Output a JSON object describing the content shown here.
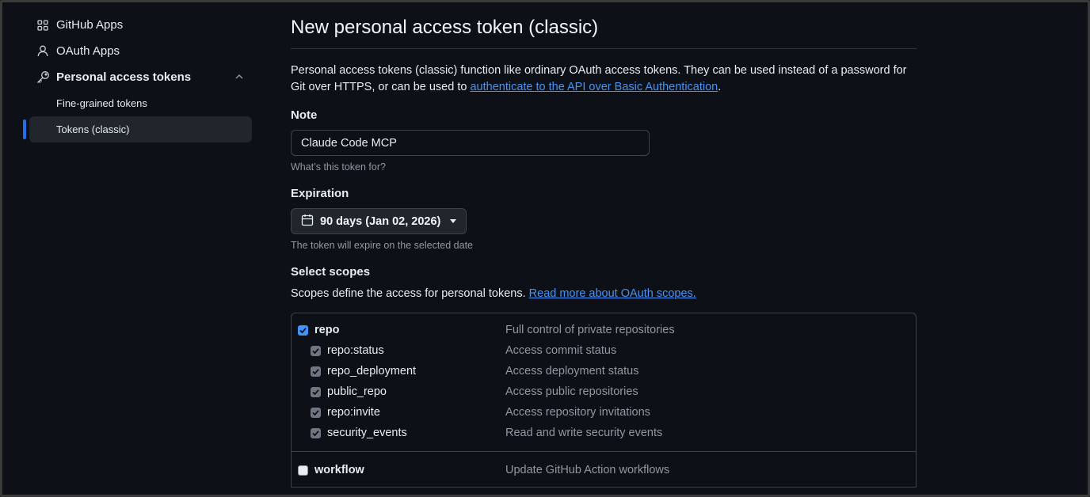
{
  "sidebar": {
    "items": [
      {
        "label": "GitHub Apps",
        "icon": "apps-grid-icon"
      },
      {
        "label": "OAuth Apps",
        "icon": "person-icon"
      },
      {
        "label": "Personal access tokens",
        "icon": "key-icon"
      }
    ],
    "sub_items": [
      {
        "label": "Fine-grained tokens"
      },
      {
        "label": "Tokens (classic)",
        "active": true
      }
    ]
  },
  "main": {
    "title": "New personal access token (classic)",
    "description_prefix": "Personal access tokens (classic) function like ordinary OAuth access tokens. They can be used instead of a password for Git over HTTPS, or can be used to ",
    "description_link": "authenticate to the API over Basic Authentication",
    "description_suffix": ".",
    "note": {
      "label": "Note",
      "value": "Claude Code MCP",
      "hint": "What’s this token for?"
    },
    "expiration": {
      "label": "Expiration",
      "selected": "90 days (Jan 02, 2026)",
      "hint": "The token will expire on the selected date"
    },
    "scopes": {
      "label": "Select scopes",
      "description": "Scopes define the access for personal tokens. ",
      "link": "Read more about OAuth scopes.",
      "groups": [
        {
          "name": "repo",
          "description": "Full control of private repositories",
          "checked": true,
          "children": [
            {
              "name": "repo:status",
              "description": "Access commit status"
            },
            {
              "name": "repo_deployment",
              "description": "Access deployment status"
            },
            {
              "name": "public_repo",
              "description": "Access public repositories"
            },
            {
              "name": "repo:invite",
              "description": "Access repository invitations"
            },
            {
              "name": "security_events",
              "description": "Read and write security events"
            }
          ]
        },
        {
          "name": "workflow",
          "description": "Update GitHub Action workflows",
          "checked": false
        }
      ]
    }
  },
  "colors": {
    "background": "#0d1117",
    "accent": "#1f6feb",
    "link": "#4493f8",
    "muted_text": "#9198a1"
  }
}
